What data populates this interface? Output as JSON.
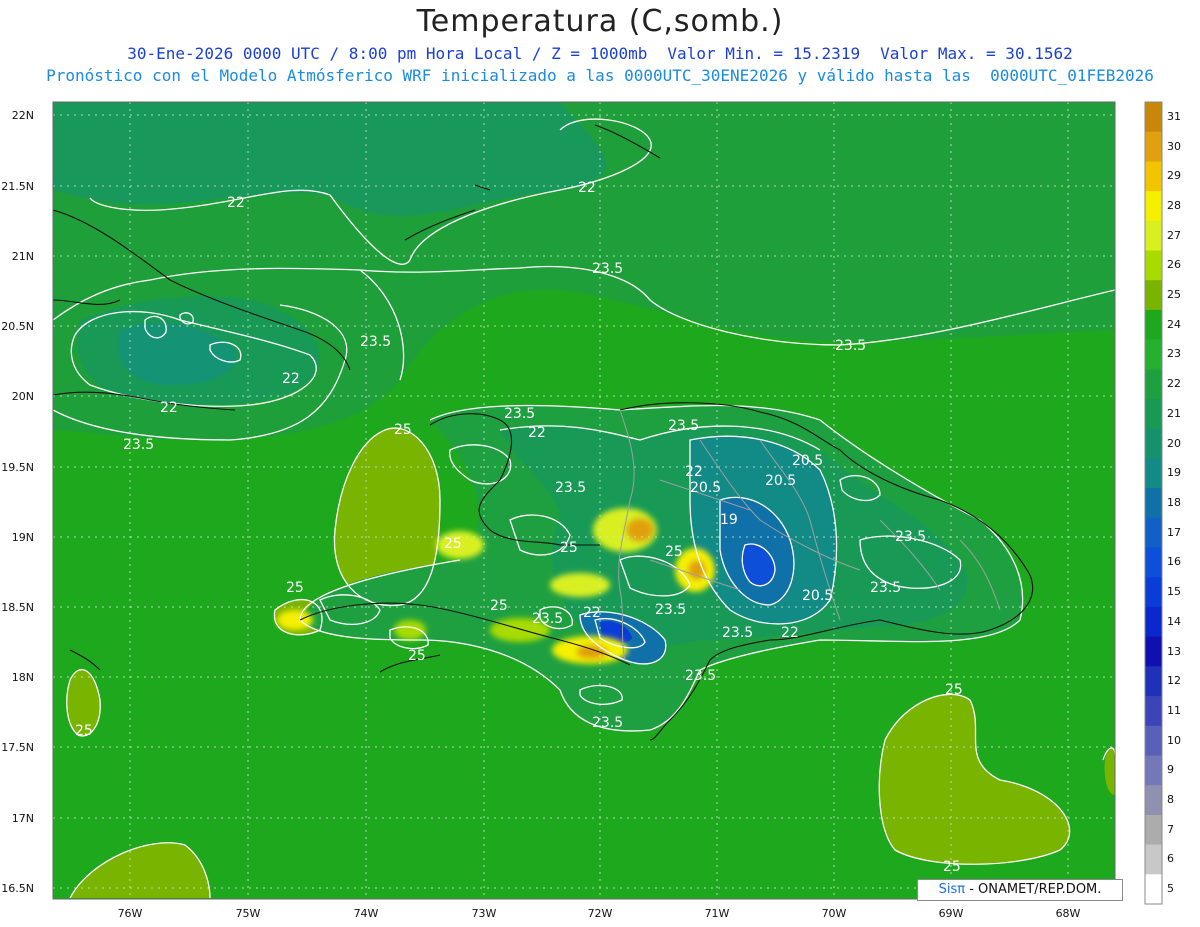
{
  "title": "Temperatura (C,somb.)",
  "subtitle_line1": {
    "date": "30-Ene-2026 0000 UTC / 8:00 pm Hora Local / Z = 1000mb",
    "min": "Valor Min. = 15.2319",
    "max": "Valor Max. = 30.1562"
  },
  "subtitle_line2": "Pronóstico con el Modelo Atmósferico WRF inicializado a las 0000UTC_30ENE2026 y válido hasta las  0000UTC_01FEB2026",
  "lat_labels": [
    "22N",
    "21.5N",
    "21N",
    "20.5N",
    "20N",
    "19.5N",
    "19N",
    "18.5N",
    "18N",
    "17.5N",
    "17N",
    "16.5N"
  ],
  "lon_labels": [
    "76W",
    "75W",
    "74W",
    "73W",
    "72W",
    "71W",
    "70W",
    "69W",
    "68W"
  ],
  "colorbar": {
    "labels": [
      "31",
      "30",
      "29",
      "28",
      "27",
      "26",
      "25",
      "24",
      "23",
      "22",
      "21",
      "20",
      "19",
      "18",
      "17",
      "16",
      "15",
      "14",
      "13",
      "12",
      "11",
      "10",
      "9",
      "8",
      "7",
      "6",
      "5"
    ],
    "colors": [
      "#c8860a",
      "#e0a010",
      "#f5c400",
      "#f5f000",
      "#d8f020",
      "#a8dc00",
      "#78b400",
      "#1ea81e",
      "#26b030",
      "#1fa040",
      "#189a56",
      "#15926c",
      "#128a86",
      "#1070a8",
      "#1060c8",
      "#0d4fd8",
      "#0a3cd8",
      "#0a28cc",
      "#1010b0",
      "#2030b8",
      "#3c44b8",
      "#5860b8",
      "#7478b8",
      "#9090b0",
      "#acacac",
      "#c8c8c8",
      "#ffffff"
    ]
  },
  "contours": {
    "labels": [
      "22",
      "22",
      "23.5",
      "23.5",
      "23.5",
      "22",
      "22",
      "23.5",
      "25",
      "23.5",
      "22",
      "20.5",
      "22",
      "20.5",
      "20.5",
      "23.5",
      "23.5",
      "25",
      "25",
      "19",
      "23.5",
      "25",
      "23.5",
      "25",
      "23.5",
      "22",
      "23.5",
      "23.5",
      "22",
      "20.5",
      "25",
      "23.5",
      "25",
      "23.5",
      "25",
      "25",
      "25"
    ]
  },
  "credit": {
    "logo": "Sisπ",
    "text": "- ONAMET/REP.DOM."
  }
}
